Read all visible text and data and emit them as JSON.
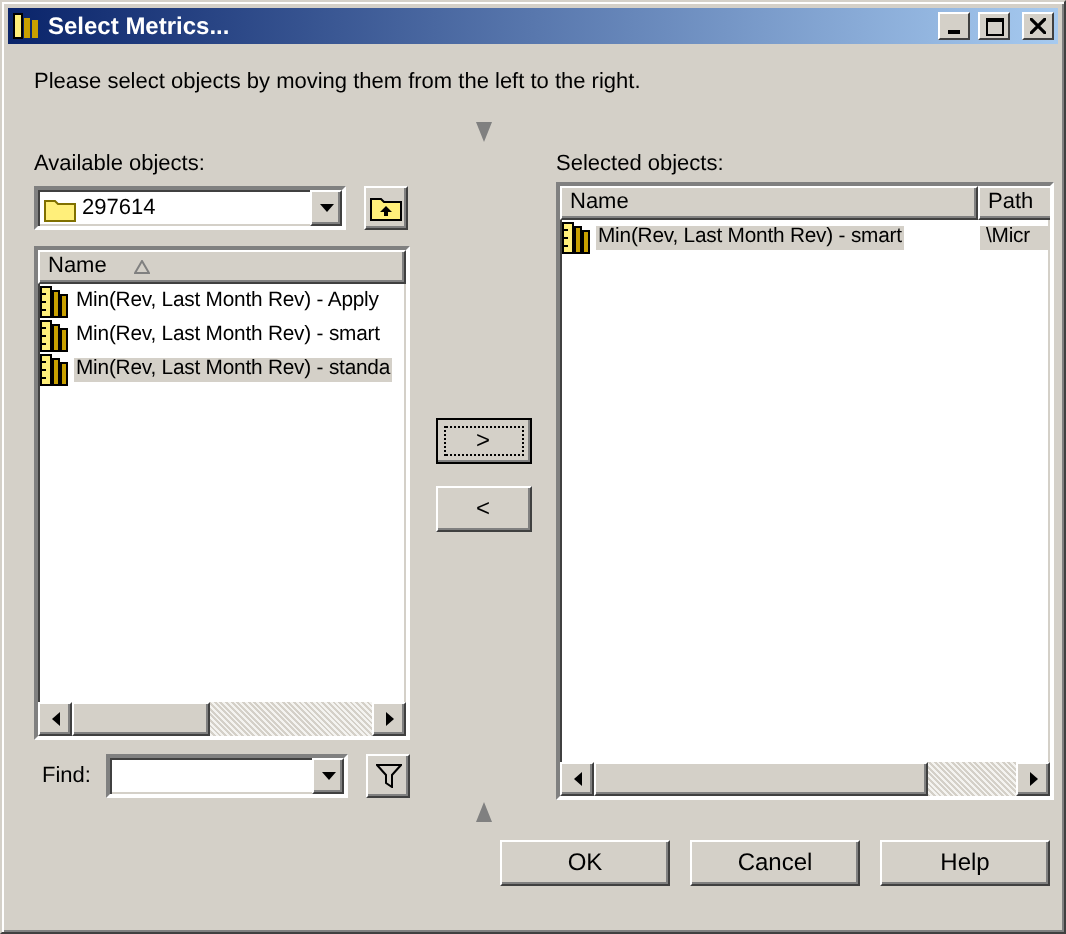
{
  "window": {
    "title": "Select Metrics..."
  },
  "instruction": "Please select objects by moving them from the left to the right.",
  "available": {
    "label": "Available objects:",
    "folder": "297614",
    "columns": [
      {
        "label": "Name",
        "sorted": true
      }
    ],
    "items": [
      {
        "name": "Min(Rev, Last Month Rev) - Apply",
        "selected": false
      },
      {
        "name": "Min(Rev, Last Month Rev) - smart",
        "selected": false
      },
      {
        "name": "Min(Rev, Last Month Rev) - standa",
        "selected": true
      }
    ]
  },
  "find": {
    "label": "Find:"
  },
  "move_buttons": [
    {
      "label": ">",
      "focused": true
    },
    {
      "label": "<",
      "focused": false
    }
  ],
  "selected": {
    "label": "Selected objects:",
    "columns": [
      {
        "label": "Name"
      },
      {
        "label": "Path"
      }
    ],
    "items": [
      {
        "name": "Min(Rev, Last Month Rev) - smart",
        "path": "\\Micr",
        "selected": true
      }
    ]
  },
  "buttons": [
    {
      "label": "OK"
    },
    {
      "label": "Cancel"
    },
    {
      "label": "Help"
    }
  ]
}
